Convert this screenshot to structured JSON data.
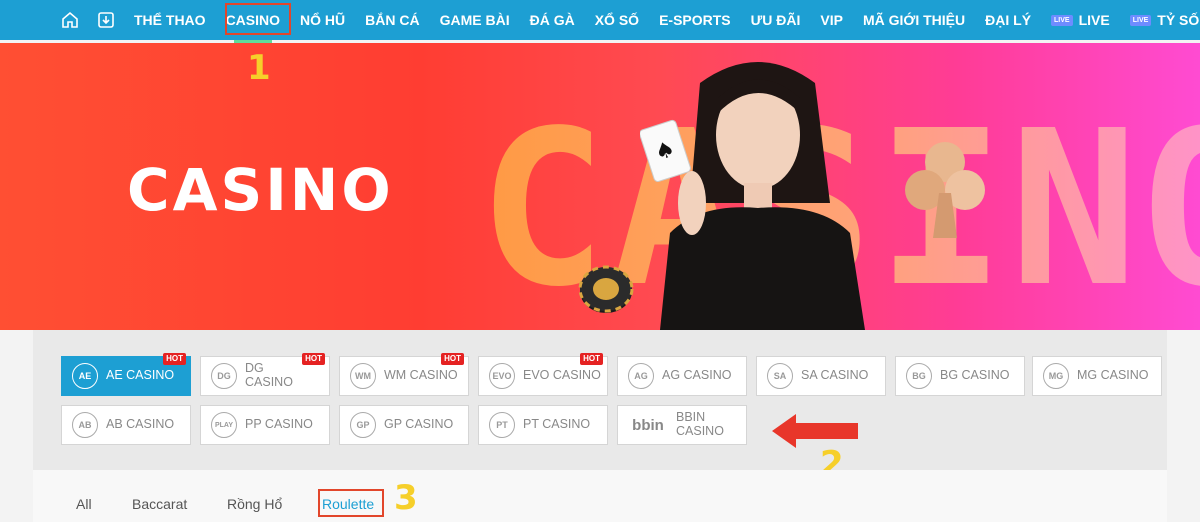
{
  "nav": {
    "home_icon": "home-icon",
    "download_icon": "download-icon",
    "items": [
      {
        "label": "THỂ THAO"
      },
      {
        "label": "CASINO"
      },
      {
        "label": "NỔ HŨ"
      },
      {
        "label": "BẮN CÁ"
      },
      {
        "label": "GAME BÀI"
      },
      {
        "label": "ĐÁ GÀ"
      },
      {
        "label": "XỔ SỐ"
      },
      {
        "label": "E-SPORTS"
      },
      {
        "label": "ƯU ĐÃI"
      },
      {
        "label": "VIP"
      },
      {
        "label": "MÃ GIỚI THIỆU"
      },
      {
        "label": "ĐẠI LÝ"
      }
    ],
    "live": {
      "badge": "LIVE",
      "label": "LIVE"
    },
    "score": {
      "badge": "LIVE",
      "label": "TỶ SỐ"
    },
    "active_color": "#1d9fd3"
  },
  "banner": {
    "title": "CASINO",
    "background_word": "CASINO"
  },
  "providers": [
    {
      "label": "AE CASINO",
      "icon": "AE",
      "hot": "HOT",
      "active": true
    },
    {
      "label": "DG CASINO",
      "icon": "DG",
      "hot": "HOT"
    },
    {
      "label": "WM CASINO",
      "icon": "WM",
      "hot": "HOT"
    },
    {
      "label": "EVO CASINO",
      "icon": "EVO",
      "hot": "HOT"
    },
    {
      "label": "AG CASINO",
      "icon": "AG"
    },
    {
      "label": "SA CASINO",
      "icon": "SA"
    },
    {
      "label": "BG CASINO",
      "icon": "BG"
    },
    {
      "label": "MG CASINO",
      "icon": "MG"
    },
    {
      "label": "AB CASINO",
      "icon": "AB"
    },
    {
      "label": "PP CASINO",
      "icon": "PLAY"
    },
    {
      "label": "GP CASINO",
      "icon": "GP"
    },
    {
      "label": "PT CASINO",
      "icon": "PT"
    },
    {
      "label": "BBIN CASINO",
      "icon": "bbin"
    }
  ],
  "filters": {
    "all": "All",
    "baccarat": "Baccarat",
    "dragon_tiger": "Rồng Hổ",
    "roulette": "Roulette"
  },
  "annotations": {
    "step1": "1",
    "step2": "2",
    "step3": "3",
    "highlight_color": "#e2462b",
    "number_color": "#f6cf2a"
  }
}
